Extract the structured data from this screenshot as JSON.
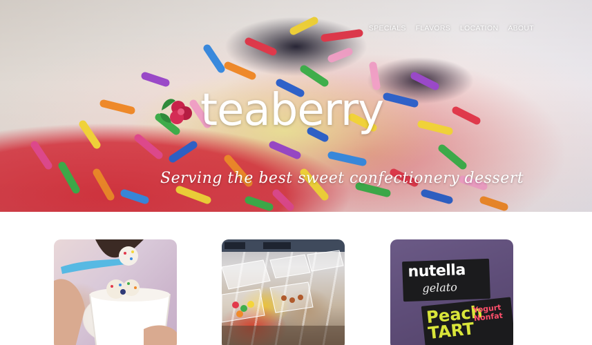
{
  "nav": {
    "links": [
      "SPECIALS",
      "FLAVORS",
      "LOCATION",
      "ABOUT"
    ]
  },
  "brand": {
    "name": "teaberry",
    "tagline": "Serving the best sweet confectionery dessert",
    "logo_icon": "berry-leaf-icon",
    "colors": {
      "berry": "#c8234a",
      "leaf": "#2f8a3b",
      "text_on_hero": "#ffffff"
    }
  },
  "cards": [
    {
      "name": "frozen-yogurt-photo"
    },
    {
      "name": "toppings-bar-photo"
    },
    {
      "name": "specials-signs-photo",
      "sign_1": {
        "line_1": "nutella",
        "line_2": "gelato"
      },
      "sign_2": {
        "line_1": "Peach",
        "line_2": "TART",
        "line_3": "Yogurt",
        "line_4": "Nonfat"
      }
    }
  ]
}
